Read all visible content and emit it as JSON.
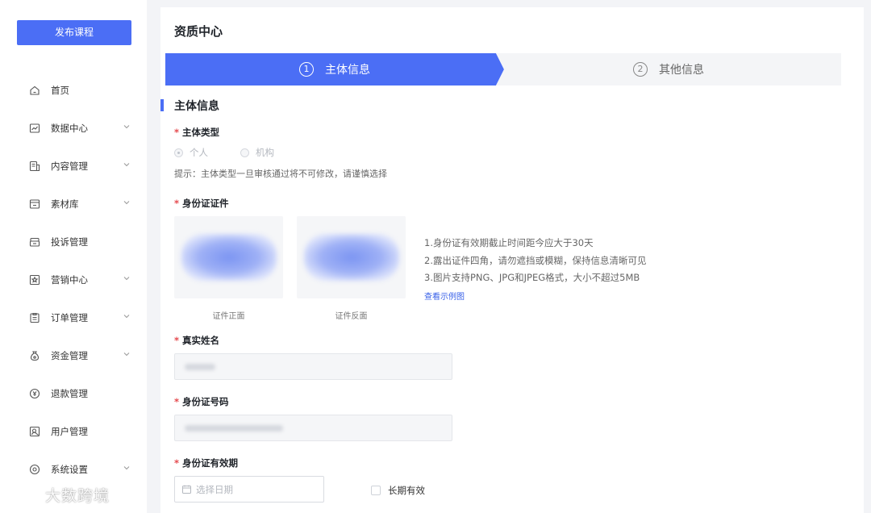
{
  "sidebar": {
    "publish_label": "发布课程",
    "items": [
      {
        "label": "首页",
        "icon": "home-icon",
        "has_submenu": false
      },
      {
        "label": "数据中心",
        "icon": "chart-icon",
        "has_submenu": true
      },
      {
        "label": "内容管理",
        "icon": "content-icon",
        "has_submenu": true
      },
      {
        "label": "素材库",
        "icon": "folder-icon",
        "has_submenu": true
      },
      {
        "label": "投诉管理",
        "icon": "complaint-icon",
        "has_submenu": false
      },
      {
        "label": "营销中心",
        "icon": "marketing-icon",
        "has_submenu": true
      },
      {
        "label": "订单管理",
        "icon": "order-icon",
        "has_submenu": true
      },
      {
        "label": "资金管理",
        "icon": "money-bag-icon",
        "has_submenu": true
      },
      {
        "label": "退款管理",
        "icon": "refund-icon",
        "has_submenu": false
      },
      {
        "label": "用户管理",
        "icon": "user-icon",
        "has_submenu": false
      },
      {
        "label": "系统设置",
        "icon": "settings-icon",
        "has_submenu": true
      }
    ]
  },
  "watermark": {
    "text": "大数跨境"
  },
  "main": {
    "page_title": "资质中心",
    "steps": [
      {
        "num": "1",
        "label": "主体信息",
        "active": true
      },
      {
        "num": "2",
        "label": "其他信息",
        "active": false
      }
    ],
    "section_title": "主体信息",
    "subject_type": {
      "label": "主体类型",
      "options": [
        {
          "label": "个人",
          "checked": true
        },
        {
          "label": "机构",
          "checked": false
        }
      ],
      "hint": "提示：主体类型一旦审核通过将不可修改，请谨慎选择"
    },
    "id_documents": {
      "label": "身份证证件",
      "front_caption": "证件正面",
      "back_caption": "证件反面",
      "requirements": [
        "1.身份证有效期截止时间距今应大于30天",
        "2.露出证件四角，请勿遮挡或模糊，保持信息清晰可见",
        "3.图片支持PNG、JPG和JPEG格式，大小不超过5MB"
      ],
      "sample_link": "查看示例图"
    },
    "real_name": {
      "label": "真实姓名"
    },
    "id_number": {
      "label": "身份证号码"
    },
    "id_validity": {
      "label": "身份证有效期",
      "date_placeholder": "选择日期",
      "long_term_label": "长期有效",
      "long_term_checked": false
    }
  },
  "colors": {
    "accent": "#4b6ef5",
    "required": "#e5484d",
    "link": "#3a62e8",
    "page_bg": "#f3f4f7"
  }
}
